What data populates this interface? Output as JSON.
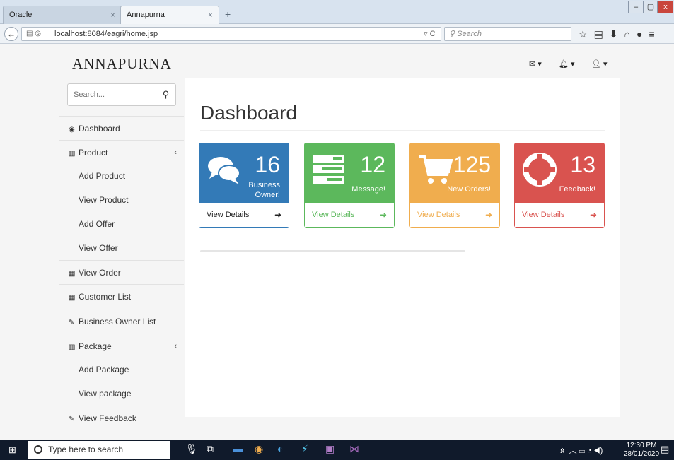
{
  "browser": {
    "tabs": [
      {
        "label": "Oracle"
      },
      {
        "label": "Annapurna"
      }
    ],
    "new_tab": "+",
    "url": "localhost:8084/eagri/home.jsp",
    "search_placeholder": "Search",
    "window_controls": {
      "minimize": "–",
      "maximize": "▢",
      "close": "x"
    },
    "toolbar_icons": [
      "star-icon",
      "bookmark-icon",
      "download-icon",
      "home-icon",
      "chat-icon",
      "menu-icon"
    ]
  },
  "app": {
    "brand": "ANNAPURNA",
    "top_icons": [
      "envelope-icon",
      "bell-icon",
      "user-icon"
    ]
  },
  "sidebar": {
    "search_placeholder": "Search...",
    "items": [
      {
        "label": "Dashboard",
        "icon": "dashboard-icon"
      },
      {
        "label": "Product",
        "icon": "bar-chart-icon"
      },
      {
        "label": "Add Product"
      },
      {
        "label": "View Product"
      },
      {
        "label": "Add Offer"
      },
      {
        "label": "View Offer"
      },
      {
        "label": "View Order",
        "icon": "table-icon"
      },
      {
        "label": "Customer List",
        "icon": "table-icon"
      },
      {
        "label": "Business Owner List",
        "icon": "edit-icon"
      },
      {
        "label": "Package",
        "icon": "bar-chart-icon"
      },
      {
        "label": "Add Package"
      },
      {
        "label": "View package"
      },
      {
        "label": "View Feedback",
        "icon": "edit-icon"
      }
    ]
  },
  "main": {
    "title": "Dashboard",
    "panels": [
      {
        "count": "16",
        "label": "Business Owner!",
        "footer": "View Details",
        "icon": "comments-icon",
        "color": "#337ab7"
      },
      {
        "count": "12",
        "label": "Message!",
        "footer": "View Details",
        "icon": "tasks-icon",
        "color": "#5cb85c"
      },
      {
        "count": "125",
        "label": "New Orders!",
        "footer": "View Details",
        "icon": "shopping-cart-icon",
        "color": "#f0ad4e"
      },
      {
        "count": "13",
        "label": "Feedback!",
        "footer": "View Details",
        "icon": "support-icon",
        "color": "#d9534f"
      }
    ]
  },
  "taskbar": {
    "search_placeholder": "Type here to search",
    "time": "12:30 PM",
    "date": "28/01/2020"
  }
}
